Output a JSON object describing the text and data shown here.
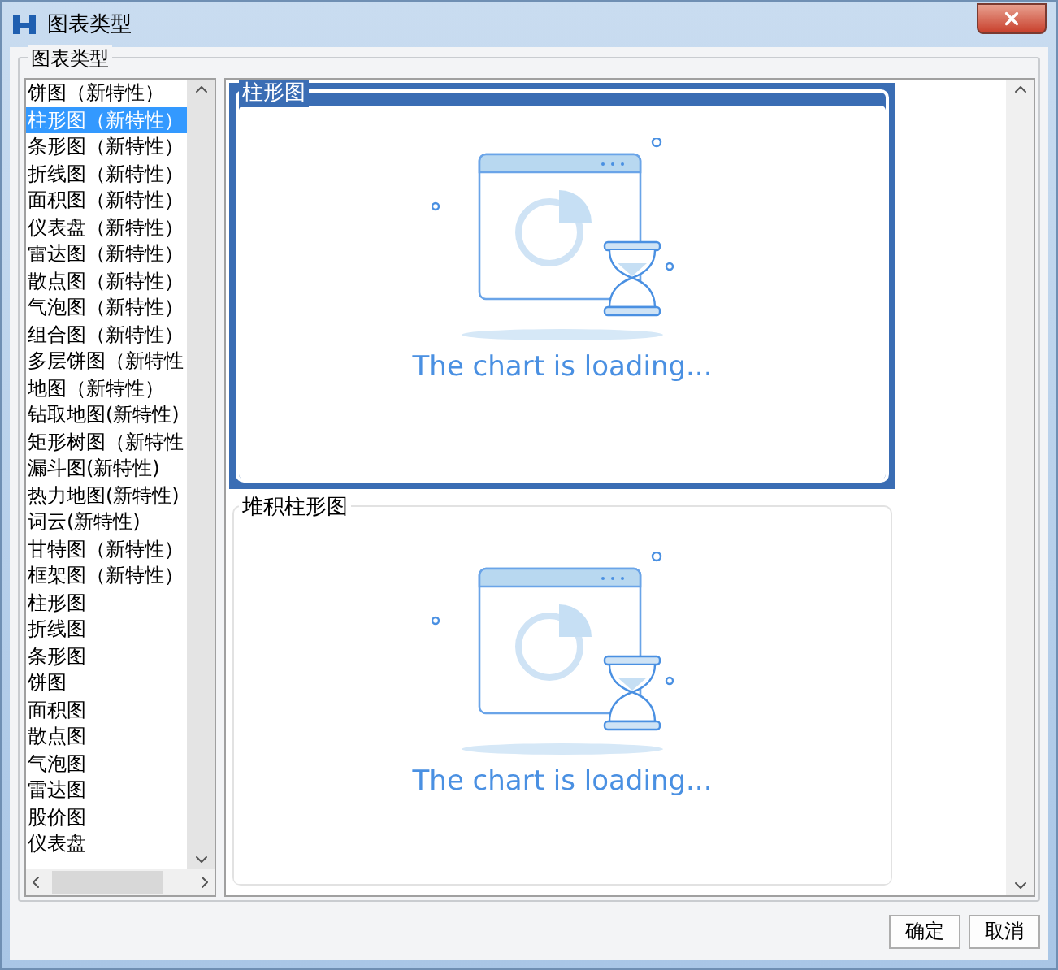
{
  "window": {
    "title": "图表类型"
  },
  "group": {
    "label": "图表类型"
  },
  "chart_types": [
    {
      "label": "饼图（新特性）",
      "selected": false
    },
    {
      "label": "柱形图（新特性）",
      "selected": true
    },
    {
      "label": "条形图（新特性）",
      "selected": false
    },
    {
      "label": "折线图（新特性）",
      "selected": false
    },
    {
      "label": "面积图（新特性）",
      "selected": false
    },
    {
      "label": "仪表盘（新特性）",
      "selected": false
    },
    {
      "label": "雷达图（新特性）",
      "selected": false
    },
    {
      "label": "散点图（新特性）",
      "selected": false
    },
    {
      "label": "气泡图（新特性）",
      "selected": false
    },
    {
      "label": "组合图（新特性）",
      "selected": false
    },
    {
      "label": "多层饼图（新特性",
      "selected": false
    },
    {
      "label": "地图（新特性）",
      "selected": false
    },
    {
      "label": "钻取地图(新特性)",
      "selected": false
    },
    {
      "label": "矩形树图（新特性",
      "selected": false
    },
    {
      "label": "漏斗图(新特性)",
      "selected": false
    },
    {
      "label": "热力地图(新特性)",
      "selected": false
    },
    {
      "label": "词云(新特性)",
      "selected": false
    },
    {
      "label": "甘特图（新特性）",
      "selected": false
    },
    {
      "label": "框架图（新特性）",
      "selected": false
    },
    {
      "label": "柱形图",
      "selected": false
    },
    {
      "label": "折线图",
      "selected": false
    },
    {
      "label": "条形图",
      "selected": false
    },
    {
      "label": "饼图",
      "selected": false
    },
    {
      "label": "面积图",
      "selected": false
    },
    {
      "label": "散点图",
      "selected": false
    },
    {
      "label": "气泡图",
      "selected": false
    },
    {
      "label": "雷达图",
      "selected": false
    },
    {
      "label": "股价图",
      "selected": false
    },
    {
      "label": "仪表盘",
      "selected": false
    }
  ],
  "previews": [
    {
      "title": "柱形图",
      "message": "The chart is loading...",
      "selected": true
    },
    {
      "title": "堆积柱形图",
      "message": "The chart is loading...",
      "selected": false
    }
  ],
  "buttons": [
    "确定",
    "取消"
  ]
}
